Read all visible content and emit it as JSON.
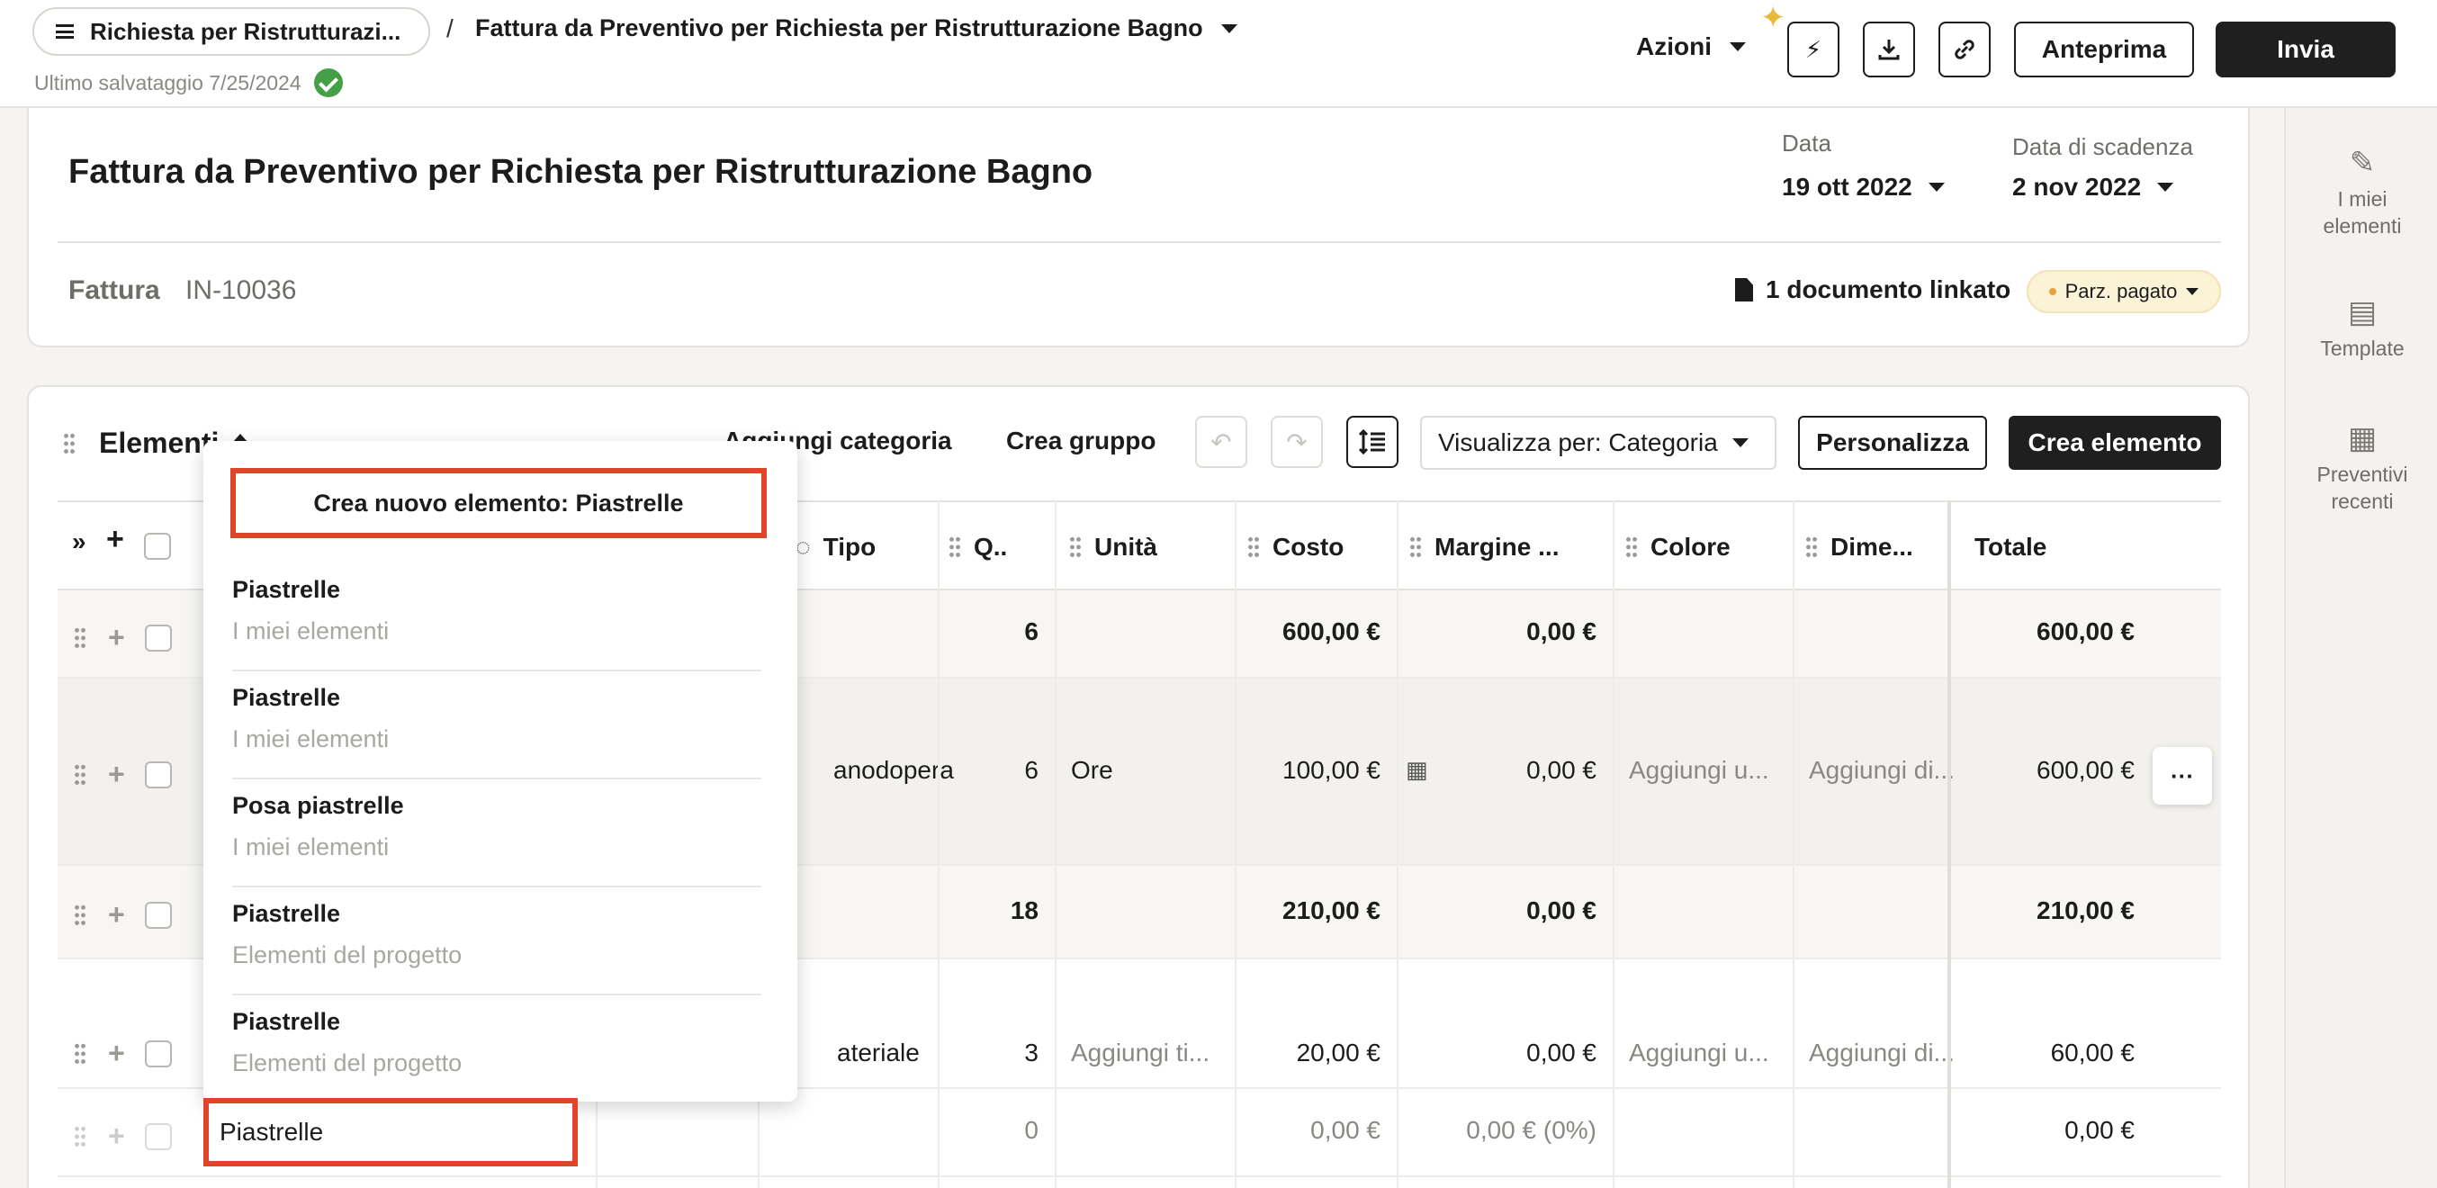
{
  "topbar": {
    "project_pill": "Richiesta per Ristrutturazi...",
    "separator": "/",
    "doc_title": "Fattura da Preventivo per Richiesta per Ristrutturazione Bagno",
    "last_saved": "Ultimo salvataggio 7/25/2024",
    "azioni_label": "Azioni",
    "anteprima_label": "Anteprima",
    "invia_label": "Invia"
  },
  "rail": {
    "items": [
      {
        "line1": "I miei",
        "line2": "elementi"
      },
      {
        "line1": "Template",
        "line2": ""
      },
      {
        "line1": "Preventivi",
        "line2": "recenti"
      }
    ]
  },
  "header": {
    "title": "Fattura da Preventivo per Richiesta per Ristrutturazione Bagno",
    "data_label": "Data",
    "data_value": "19 ott 2022",
    "scadenza_label": "Data di scadenza",
    "scadenza_value": "2 nov 2022",
    "fattura_label": "Fattura",
    "fattura_number": "IN-10036",
    "linked_docs": "1 documento linkato",
    "status": "Parz. pagato"
  },
  "items_section": {
    "title": "Elementi",
    "add_category": "Aggiungi categoria",
    "create_group": "Crea gruppo",
    "view_by": "Visualizza per: Categoria",
    "customize": "Personalizza",
    "create_item": "Crea elemento"
  },
  "table": {
    "columns": {
      "tipo": "Tipo",
      "qty": "Q..",
      "unita": "Unità",
      "costo": "Costo",
      "margine": "Margine ...",
      "colore": "Colore",
      "dimensioni": "Dime...",
      "totale": "Totale"
    },
    "rows": [
      {
        "tipo": "",
        "qty": "6",
        "unita": "",
        "costo": "600,00 €",
        "margine": "0,00 €",
        "colore": "",
        "dimensioni": "",
        "totale": "600,00 €"
      },
      {
        "tipo": "anodopera",
        "qty": "6",
        "unita": "Ore",
        "costo": "100,00 €",
        "margine": "0,00 €",
        "colore": "Aggiungi u...",
        "dimensioni": "Aggiungi di...",
        "totale": "600,00 €"
      },
      {
        "tipo": "",
        "qty": "18",
        "unita": "",
        "costo": "210,00 €",
        "margine": "0,00 €",
        "colore": "",
        "dimensioni": "",
        "totale": "210,00 €"
      },
      {
        "tipo": "ateriale",
        "qty": "3",
        "unita": "Aggiungi ti...",
        "costo": "20,00 €",
        "margine": "0,00 €",
        "colore": "Aggiungi u...",
        "dimensioni": "Aggiungi di...",
        "totale": "60,00 €"
      },
      {
        "tipo": "",
        "qty": "0",
        "unita": "",
        "costo": "0,00 €",
        "margine": "0,00 € (0%)",
        "colore": "",
        "dimensioni": "",
        "totale": "0,00 €"
      }
    ],
    "more_label": "···"
  },
  "dropdown": {
    "create_new": "Crea nuovo elemento: Piastrelle",
    "options": [
      {
        "name": "Piastrelle",
        "source": "I miei elementi"
      },
      {
        "name": "Piastrelle",
        "source": "I miei elementi"
      },
      {
        "name": "Posa piastrelle",
        "source": "I miei elementi"
      },
      {
        "name": "Piastrelle",
        "source": "Elementi del progetto"
      },
      {
        "name": "Piastrelle",
        "source": "Elementi del progetto"
      }
    ]
  },
  "name_input": {
    "value": "Piastrelle"
  },
  "colors": {
    "accent_red": "#e0452a",
    "dark": "#1f1f1f",
    "success": "#43a047",
    "status_bg": "#fbf3d6"
  },
  "icons": [
    "menu-icon",
    "chevron-down-icon",
    "check-circle-icon",
    "sparkle-icon",
    "lightning-icon",
    "download-icon",
    "link-icon",
    "tools-icon",
    "clipboard-icon",
    "calculator-icon",
    "document-icon",
    "drag-handle-icon",
    "plus-icon",
    "collapse-icon",
    "undo-icon",
    "redo-icon",
    "line-spacing-icon",
    "eye-off-icon",
    "more-icon"
  ]
}
